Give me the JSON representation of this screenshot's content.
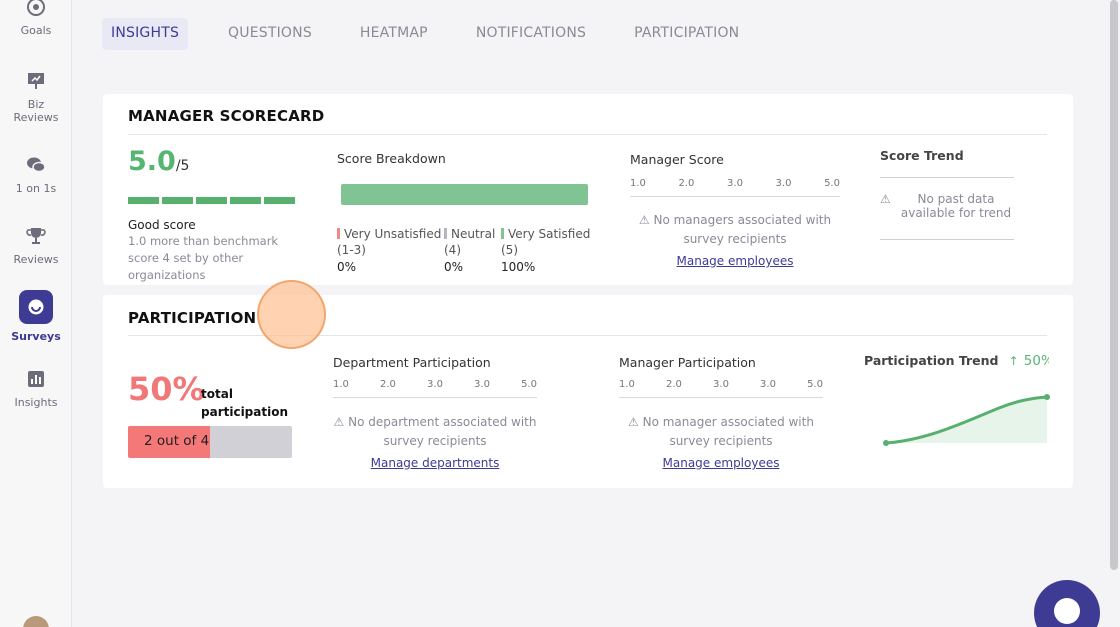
{
  "sidebar": {
    "items": [
      {
        "label": "Goals",
        "icon": "target-icon"
      },
      {
        "label": "Biz\nReviews",
        "icon": "presentation-icon"
      },
      {
        "label": "1 on 1s",
        "icon": "chat-bubbles-icon"
      },
      {
        "label": "Reviews",
        "icon": "trophy-icon"
      },
      {
        "label": "Surveys",
        "icon": "survey-icon",
        "active": true
      },
      {
        "label": "Insights",
        "icon": "bar-chart-icon"
      }
    ]
  },
  "tabs": [
    "INSIGHTS",
    "QUESTIONS",
    "HEATMAP",
    "NOTIFICATIONS",
    "PARTICIPATION"
  ],
  "scorecard": {
    "title": "MANAGER SCORECARD",
    "score": "5.0",
    "score_den": "/5",
    "segments_filled": 5,
    "good_label": "Good score",
    "benchmark_text": "1.0 more than benchmark score 4 set by other organizations",
    "breakdown": {
      "title": "Score Breakdown",
      "items": [
        {
          "label": "Very Unsatisfied (1-3)",
          "pct": "0%",
          "color": "#f08a8a"
        },
        {
          "label": "Neutral (4)",
          "pct": "0%",
          "color": "#b5b5bd"
        },
        {
          "label": "Very Satisfied (5)",
          "pct": "100%",
          "color": "#7fc492"
        }
      ]
    },
    "manager_score": {
      "title": "Manager Score",
      "axis": [
        "1.0",
        "2.0",
        "3.0",
        "3.0",
        "5.0"
      ],
      "empty_msg": "No managers associated with survey recipients",
      "link": "Manage employees"
    },
    "score_trend": {
      "title": "Score Trend",
      "empty_msg": "No past data available for trend"
    }
  },
  "participation": {
    "title": "PARTICIPATION",
    "pct": "50%",
    "pct_label": "total participation",
    "progress_text": "2 out of 4",
    "progress_fraction": 0.5,
    "department": {
      "title": "Department Participation",
      "axis": [
        "1.0",
        "2.0",
        "3.0",
        "3.0",
        "5.0"
      ],
      "empty_msg": "No department associated with survey recipients",
      "link": "Manage departments"
    },
    "manager": {
      "title": "Manager Participation",
      "axis": [
        "1.0",
        "2.0",
        "3.0",
        "3.0",
        "5.0"
      ],
      "empty_msg": "No manager associated with survey recipients",
      "link": "Manage employees"
    },
    "trend": {
      "title": "Participation Trend",
      "value": "50%..."
    }
  },
  "colors": {
    "accent": "#3d3b94",
    "good": "#57b572",
    "alert": "#f07878"
  }
}
